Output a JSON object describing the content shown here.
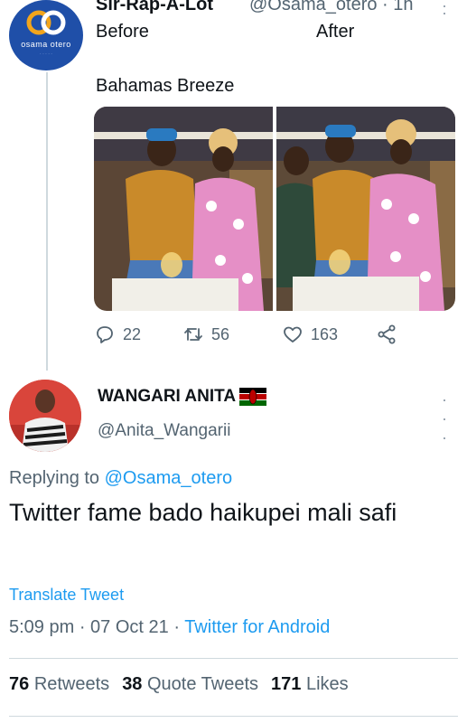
{
  "tweet": {
    "author_name": "Sir-Rap-A-Lot",
    "author_handle": "@Osama_otero · 1h",
    "avatar_brand": "osama otero",
    "line_before": "Before",
    "line_after": "After",
    "line_place": "Bahamas Breeze",
    "stats": {
      "replies": "22",
      "retweets": "56",
      "likes": "163"
    },
    "icons": [
      "reply-icon",
      "retweet-icon",
      "like-icon",
      "share-icon",
      "more-icon"
    ]
  },
  "reply": {
    "author_name": "WANGARI ANITA",
    "author_handle": "@Anita_Wangarii",
    "replying_prefix": "Replying to",
    "replying_to": "@Osama_otero",
    "text": "Twitter fame bado haikupei mali safi",
    "translate_label": "Translate Tweet",
    "time": "5:09 pm",
    "date": "07 Oct 21",
    "source": "Twitter for Android",
    "retweets_count": "76",
    "retweets_label": "Retweets",
    "quote_count": "38",
    "quote_label": "Quote Tweets",
    "likes_count": "171",
    "likes_label": "Likes"
  },
  "colors": {
    "link": "#1d9bf0",
    "secondary_text": "#536471",
    "primary_text": "#0f1419",
    "divider": "#cfd9de",
    "brand_avatar": "#1f4fa8"
  }
}
